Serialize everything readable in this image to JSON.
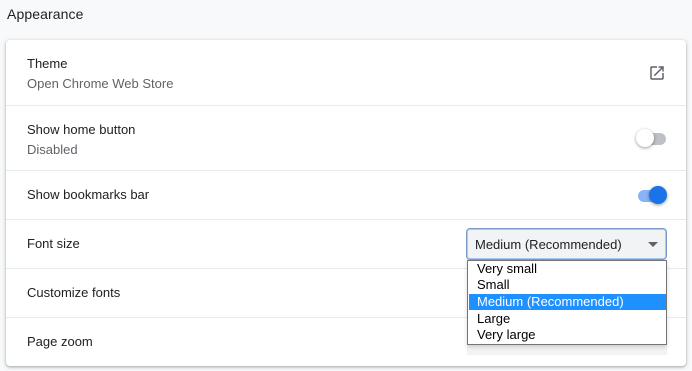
{
  "section": {
    "title": "Appearance"
  },
  "rows": {
    "theme": {
      "label": "Theme",
      "sublabel": "Open Chrome Web Store",
      "icon": "open-in-new-icon"
    },
    "home_button": {
      "label": "Show home button",
      "sublabel": "Disabled",
      "enabled": false
    },
    "bookmarks_bar": {
      "label": "Show bookmarks bar",
      "enabled": true
    },
    "font_size": {
      "label": "Font size",
      "selected": "Medium (Recommended)"
    },
    "customize_fonts": {
      "label": "Customize fonts"
    },
    "page_zoom": {
      "label": "Page zoom"
    }
  },
  "font_size_options": [
    "Very small",
    "Small",
    "Medium (Recommended)",
    "Large",
    "Very large"
  ],
  "colors": {
    "accent": "#1a73e8",
    "accent_track": "#8ab4f8",
    "selected_option_bg": "#1e90ff",
    "divider": "#e8eaed"
  }
}
